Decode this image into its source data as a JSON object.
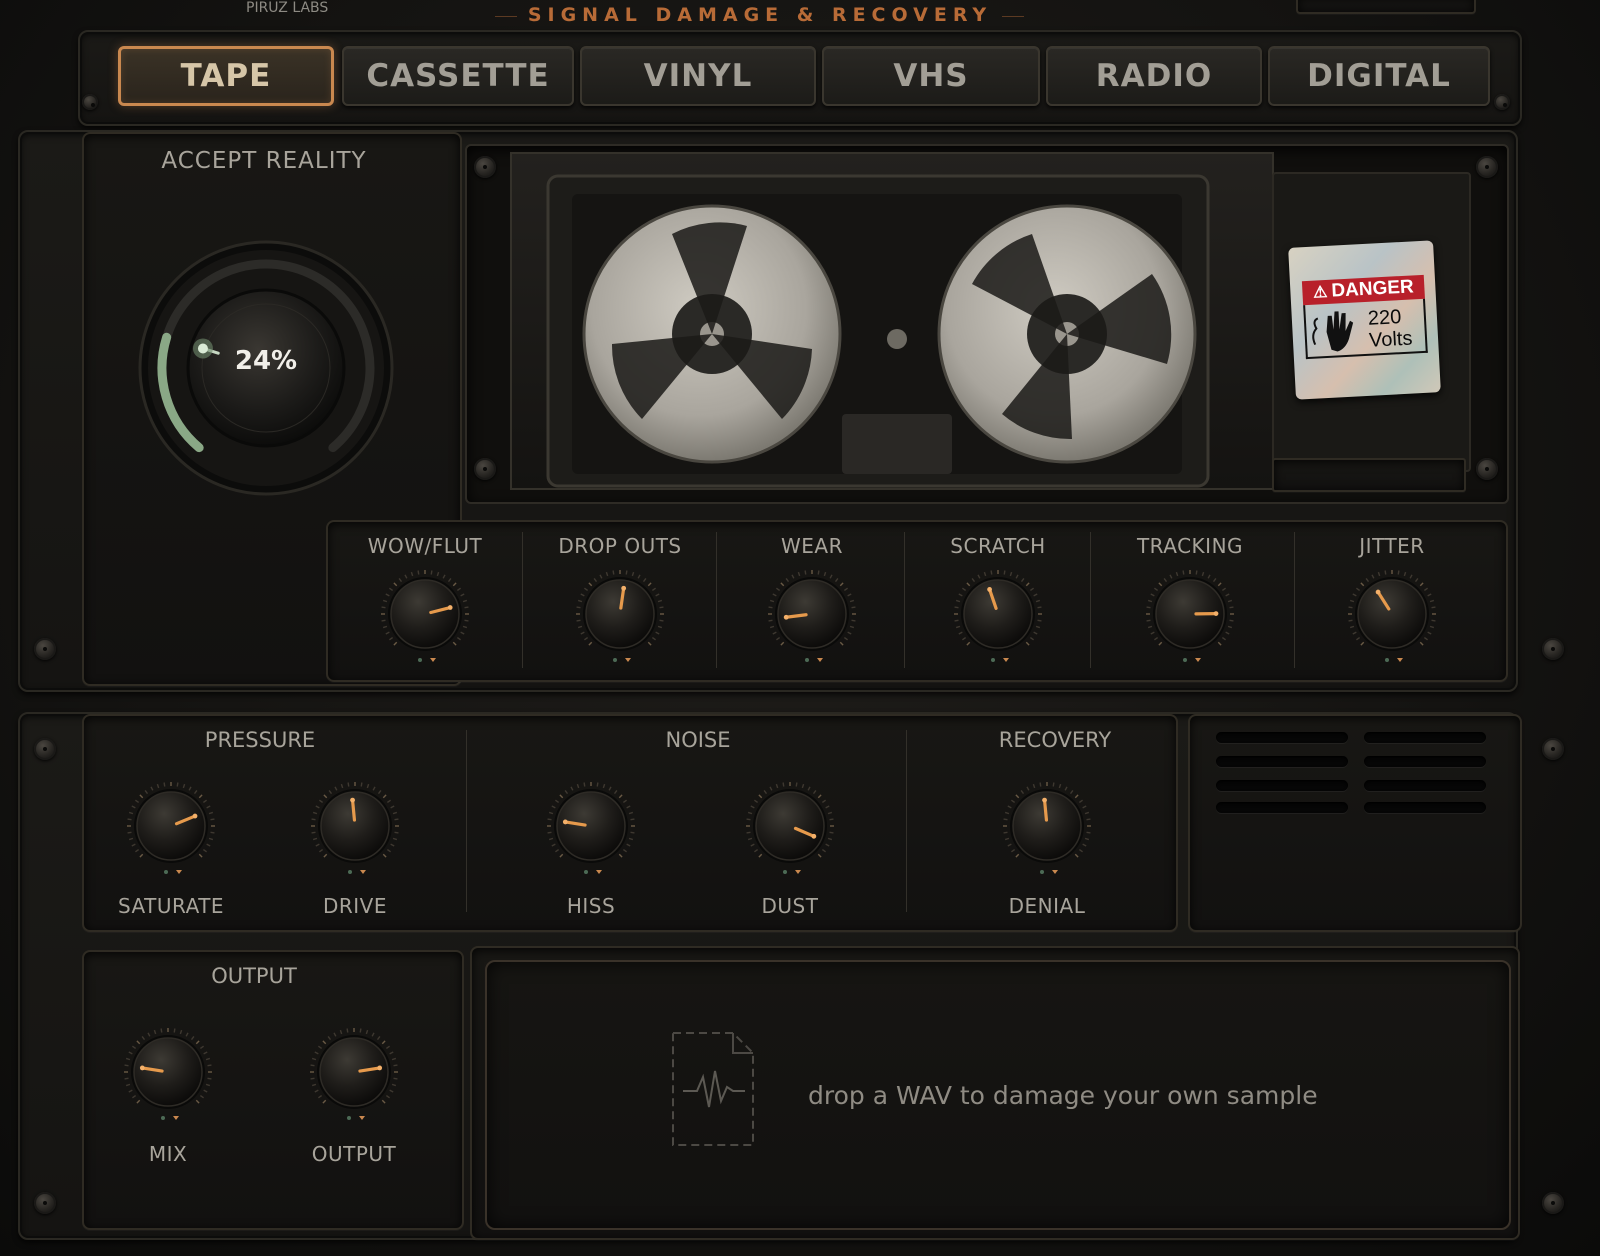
{
  "header": {
    "brand": "PIRUZ LABS",
    "title": "SIGNAL DAMAGE & RECOVERY"
  },
  "tabs": [
    {
      "label": "TAPE",
      "active": true
    },
    {
      "label": "CASSETTE",
      "active": false
    },
    {
      "label": "VINYL",
      "active": false
    },
    {
      "label": "VHS",
      "active": false
    },
    {
      "label": "RADIO",
      "active": false
    },
    {
      "label": "DIGITAL",
      "active": false
    }
  ],
  "main_knob": {
    "title": "ACCEPT REALITY",
    "value_text": "24%",
    "value": 0.24,
    "arc_color": "#8aa886"
  },
  "media": {
    "sticker": {
      "title": "DANGER",
      "line1": "220",
      "line2": "Volts"
    }
  },
  "damage_knobs": [
    {
      "label": "WOW/FLUT",
      "value": 0.78
    },
    {
      "label": "DROP OUTS",
      "value": 0.53
    },
    {
      "label": "WEAR",
      "value": 0.14
    },
    {
      "label": "SCRATCH",
      "value": 0.43
    },
    {
      "label": "TRACKING",
      "value": 0.83
    },
    {
      "label": "JITTER",
      "value": 0.38
    }
  ],
  "sections": {
    "pressure": {
      "title": "PRESSURE",
      "knobs": [
        {
          "label": "SATURATE",
          "value": 0.75
        },
        {
          "label": "DRIVE",
          "value": 0.48
        }
      ]
    },
    "noise": {
      "title": "NOISE",
      "knobs": [
        {
          "label": "HISS",
          "value": 0.2
        },
        {
          "label": "DUST",
          "value": 0.92
        }
      ]
    },
    "recovery": {
      "title": "RECOVERY",
      "knobs": [
        {
          "label": "DENIAL",
          "value": 0.48
        }
      ]
    },
    "output": {
      "title": "OUTPUT",
      "knobs": [
        {
          "label": "MIX",
          "value": 0.2
        },
        {
          "label": "OUTPUT",
          "value": 0.8
        }
      ]
    }
  },
  "dropzone": {
    "text": "drop a WAV to damage your own sample",
    "icon": "waveform-file-icon"
  },
  "colors": {
    "accent": "#c9884f",
    "pointer": "#e69a4c",
    "panel": "#191815"
  }
}
